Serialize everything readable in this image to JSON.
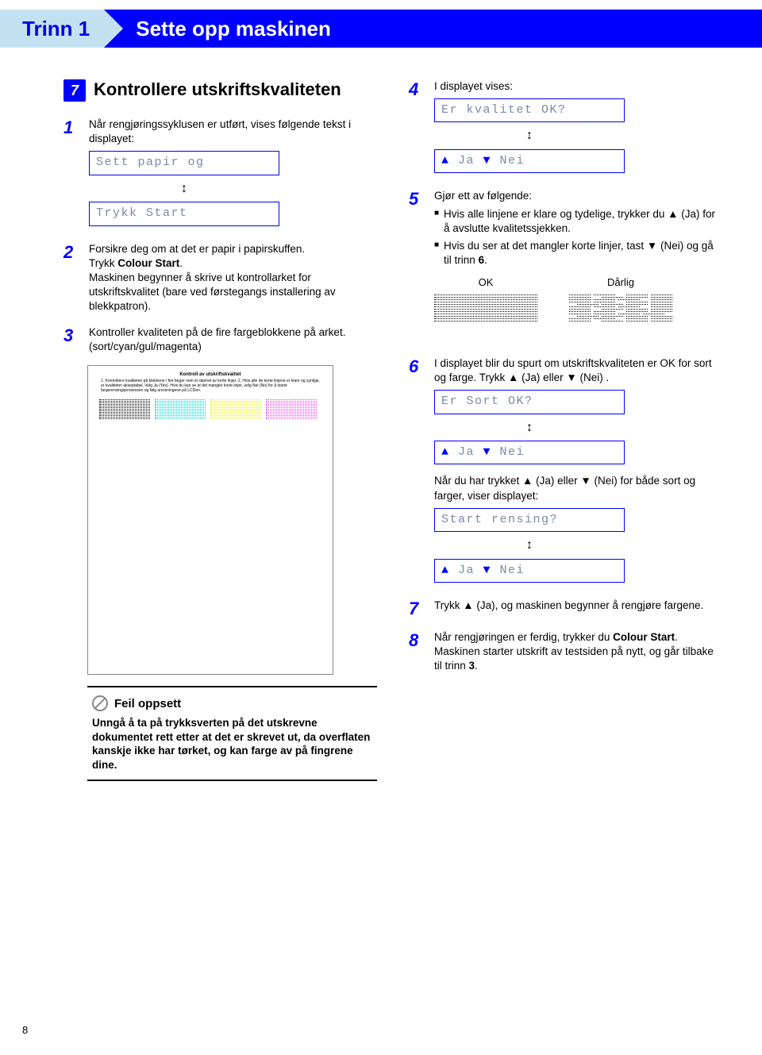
{
  "header": {
    "step_label": "Trinn 1",
    "title": "Sette opp maskinen"
  },
  "section": {
    "number": "7",
    "title": "Kontrollere utskriftskvaliteten"
  },
  "left": {
    "s1": {
      "num": "1",
      "text": "Når rengjøringssyklusen er utført, vises følgende tekst i displayet:",
      "lcd1": "Sett papir og",
      "lcd2": "Trykk Start"
    },
    "s2": {
      "num": "2",
      "l1": "Forsikre deg om at det er papir i papirskuffen.",
      "l2a": "Trykk ",
      "l2b": "Colour Start",
      "l2c": ".",
      "l3": "Maskinen begynner å skrive ut kontrollarket for utskriftskvalitet (bare ved førstegangs installering av blekkpatron)."
    },
    "s3": {
      "num": "3",
      "l1": "Kontroller kvaliteten på de fire fargeblokkene på arket.",
      "l2": "(sort/cyan/gul/magenta)"
    },
    "test_sheet": {
      "title": "Kontroll av utskriftskvalitet",
      "txt": "1. Kontrollere kvaliteten på blokkene i fire farger som er dannet av korte linjer. 2. Hvis alle de korte linjene er klare og synlige, er kvaliteten akseptabel. Velg Ja (Yes). Hvis du kan se at det mangler korte linjer, velg Nei (No) for å starte fargerensingsprosessen og følg anvisningene på LCDen."
    },
    "warning": {
      "title": "Feil oppsett",
      "text": "Unngå å ta på trykksverten på det utskrevne dokumentet rett etter at det er skrevet ut, da overflaten kanskje ikke har tørket, og kan farge av på fingrene dine."
    }
  },
  "right": {
    "s4": {
      "num": "4",
      "text": "I displayet vises:",
      "lcd1": "Er kvalitet OK?",
      "lcd2_up": "▲",
      "lcd2_ja": " Ja ",
      "lcd2_dn": "▼",
      "lcd2_nei": " Nei"
    },
    "s5": {
      "num": "5",
      "intro": "Gjør ett av følgende:",
      "b1": "Hvis alle linjene er klare og tydelige, trykker du ▲ (Ja)  for å avslutte kvalitetssjekken.",
      "b2a": "Hvis du ser at det mangler korte linjer, tast ▼ (Nei) og gå til trinn ",
      "b2b": "6",
      "b2c": ".",
      "ok_label": "OK",
      "bad_label": "Dårlig"
    },
    "s6": {
      "num": "6",
      "text": "I displayet blir du spurt om utskriftskvaliteten er OK for sort og  farge. Trykk ▲ (Ja) eller ▼ (Nei) .",
      "lcd1": "Er Sort OK?",
      "after": "Når du har trykket ▲ (Ja) eller ▼ (Nei) for både sort og farger, viser displayet:",
      "lcd3": "Start rensing?"
    },
    "s7": {
      "num": "7",
      "text": "Trykk ▲ (Ja), og maskinen begynner å rengjøre fargene."
    },
    "s8": {
      "num": "8",
      "t1": "Når rengjøringen er ferdig, trykker du ",
      "t2": "Colour Start",
      "t3": ". Maskinen starter utskrift av testsiden på nytt, og går tilbake til trinn ",
      "t4": "3",
      "t5": "."
    }
  },
  "page_number": "8"
}
